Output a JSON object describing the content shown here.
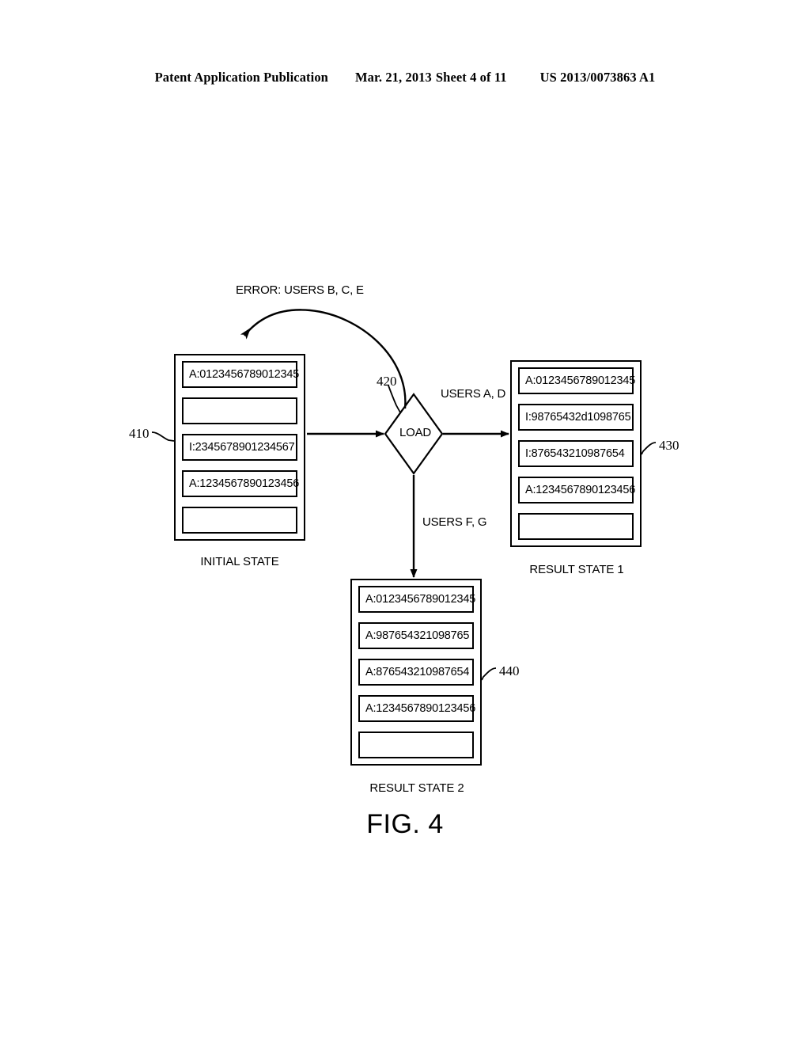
{
  "header": {
    "publication": "Patent Application Publication",
    "date": "Mar. 21, 2013",
    "sheet": "Sheet 4 of 11",
    "patent_number": "US 2013/0073863 A1"
  },
  "figure": {
    "caption": "FIG. 4",
    "process_node": {
      "label": "LOAD",
      "reference": "420"
    },
    "edge_labels": {
      "error": "ERROR: USERS B, C, E",
      "success_right": "USERS A, D",
      "success_down": "USERS F, G"
    },
    "states": [
      {
        "id": "initial-state",
        "reference": "410",
        "caption": "INITIAL STATE",
        "slots": [
          "A:0123456789012345",
          "",
          "I:2345678901234567",
          "A:1234567890123456",
          ""
        ]
      },
      {
        "id": "result-state-1",
        "reference": "430",
        "caption": "RESULT STATE 1",
        "slots": [
          "A:0123456789012345",
          "I:98765432d1098765",
          "I:876543210987654",
          "A:1234567890123456",
          ""
        ]
      },
      {
        "id": "result-state-2",
        "reference": "440",
        "caption": "RESULT STATE 2",
        "slots": [
          "A:0123456789012345",
          "A:987654321098765",
          "A:876543210987654",
          "A:1234567890123456",
          ""
        ]
      }
    ]
  },
  "colors": {
    "ink": "#000000",
    "paper": "#ffffff"
  }
}
